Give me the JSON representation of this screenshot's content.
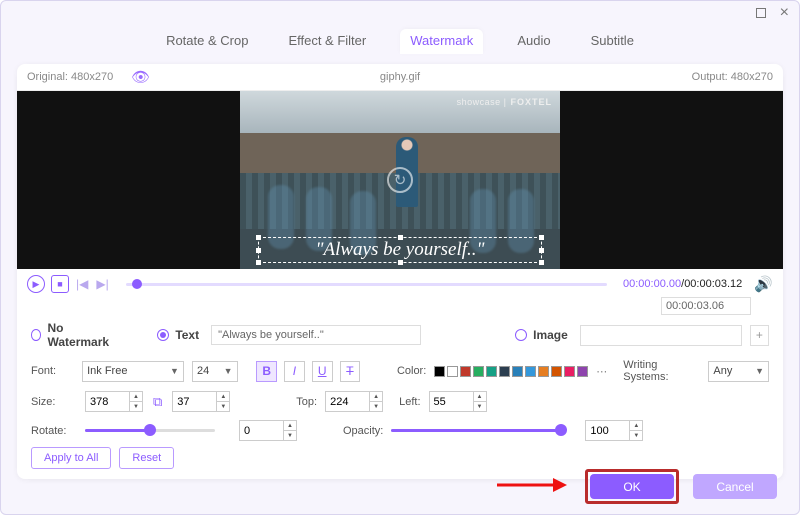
{
  "window": {
    "maximize": "",
    "close": ""
  },
  "tabs": {
    "rotate": "Rotate & Crop",
    "effect": "Effect & Filter",
    "watermark": "Watermark",
    "audio": "Audio",
    "subtitle": "Subtitle"
  },
  "info": {
    "original": "Original: 480x270",
    "filename": "giphy.gif",
    "output": "Output: 480x270"
  },
  "preview": {
    "showcase": "showcase",
    "brand": "FOXTEL",
    "watermark_text": "\"Always be yourself..\""
  },
  "player": {
    "time_left": "00:00:00.00",
    "time_sep": "/",
    "time_right": "00:00:03.12",
    "duration_value": "00:00:03.06"
  },
  "wm": {
    "no": "No Watermark",
    "text": "Text",
    "text_value": "\"Always be yourself..\"",
    "image": "Image",
    "add": "+"
  },
  "font": {
    "label": "Font:",
    "family": "Ink Free",
    "size": "24",
    "color_label": "Color:",
    "ws_label": "Writing Systems:",
    "ws_value": "Any",
    "format": {
      "b": "B",
      "i": "I",
      "u": "U",
      "s": "T"
    }
  },
  "colors": [
    "#000000",
    "#ffffff",
    "#c0392b",
    "#27ae60",
    "#16a085",
    "#2c3e50",
    "#2980b9",
    "#3498db",
    "#e67e22",
    "#d35400",
    "#e91e63",
    "#8e44ad"
  ],
  "size": {
    "label": "Size:",
    "w": "378",
    "h": "37",
    "top_label": "Top:",
    "top": "224",
    "left_label": "Left:",
    "left": "55"
  },
  "rotate": {
    "label": "Rotate:",
    "value": "0",
    "opacity_label": "Opacity:",
    "opacity": "100"
  },
  "buttons": {
    "apply": "Apply to All",
    "reset": "Reset",
    "ok": "OK",
    "cancel": "Cancel"
  }
}
